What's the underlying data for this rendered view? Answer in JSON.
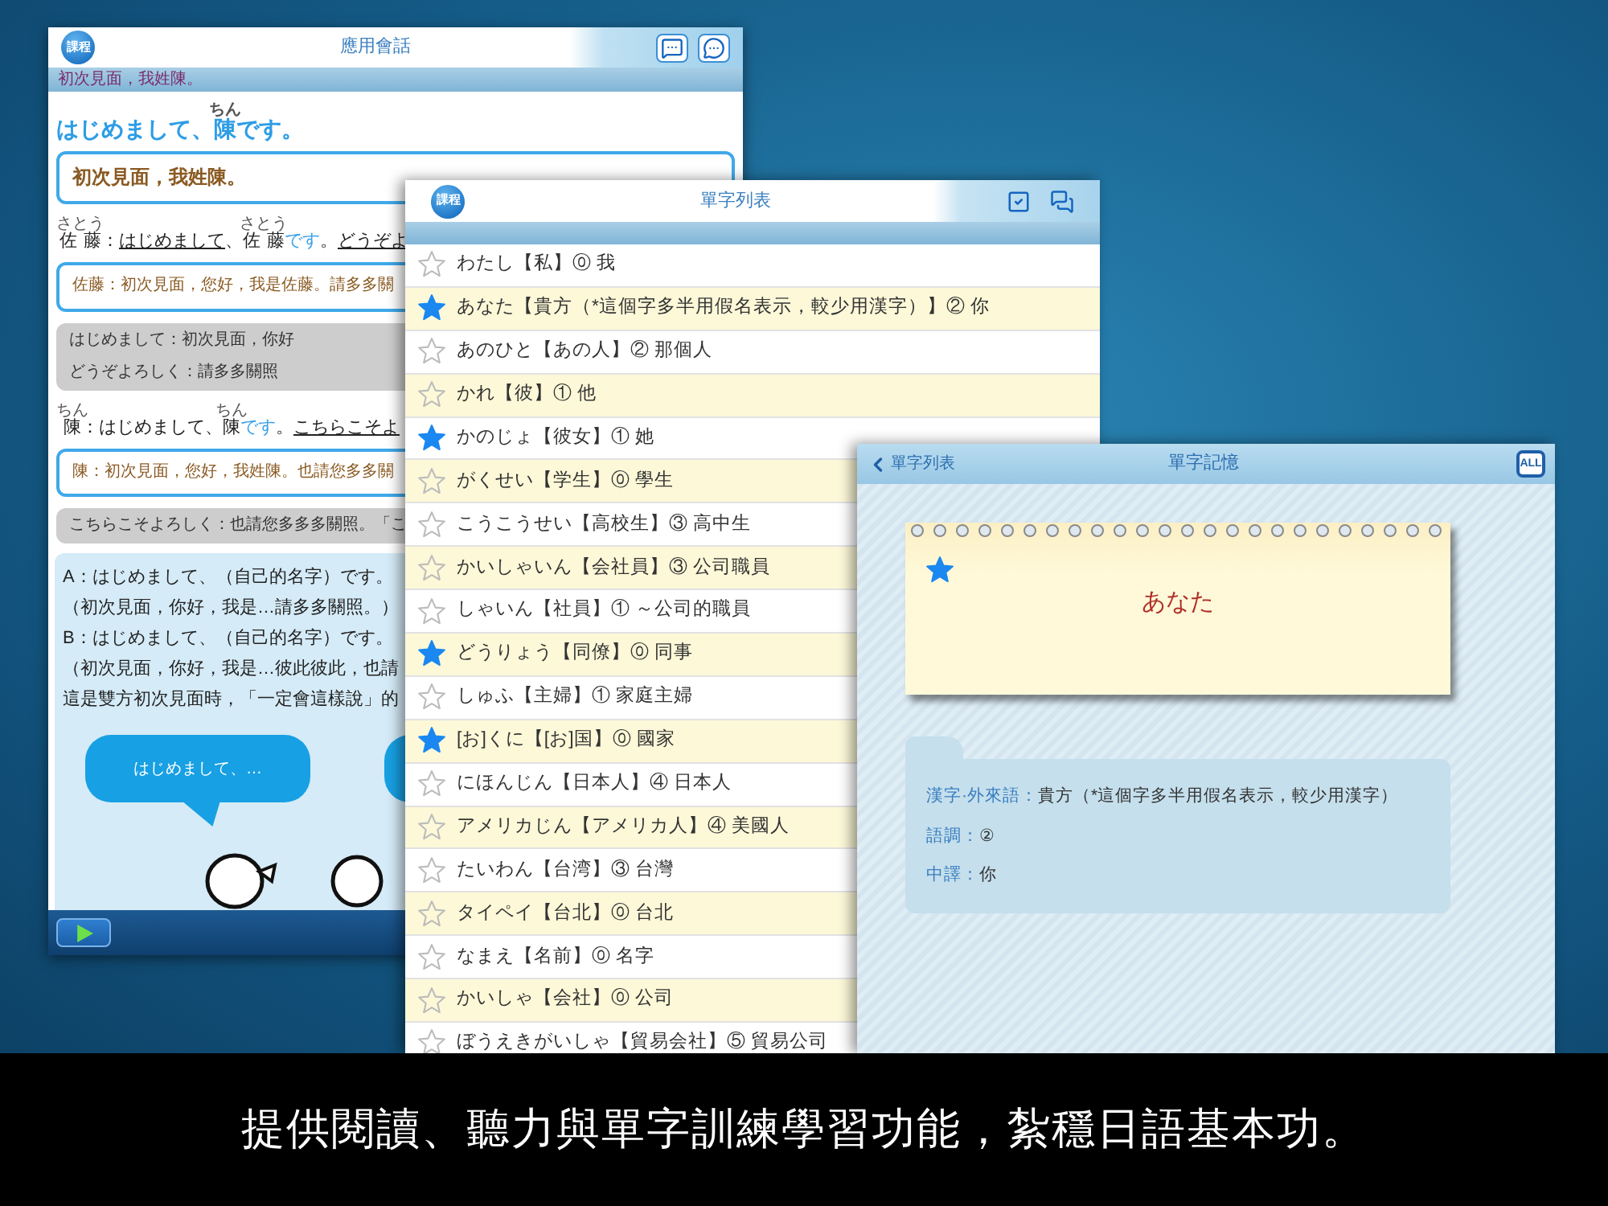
{
  "lesson_window": {
    "logo": "課程",
    "title": "應用會話",
    "subtitle": "初次見面，我姓陳。",
    "blocks": [
      {
        "kind": "headline",
        "segments": [
          {
            "text": "はじめまして、"
          },
          {
            "text": "陳",
            "ruby": "ちん"
          },
          {
            "text": "です"
          },
          {
            "text": "。"
          }
        ]
      },
      {
        "kind": "title_box",
        "lines": [
          "初次見面，我姓陳。"
        ]
      },
      {
        "kind": "speaker",
        "segments": [
          {
            "text": "佐藤",
            "ruby": "さとう"
          },
          {
            "text": "："
          },
          {
            "text": "はじめまして",
            "kind": "phrase"
          },
          {
            "text": "、"
          },
          {
            "text": "佐藤",
            "ruby": "さとう"
          },
          {
            "text": "です",
            "kind": "copula"
          },
          {
            "text": "。"
          },
          {
            "text": "どうぞよ",
            "kind": "phrase"
          }
        ]
      },
      {
        "kind": "translation_box",
        "lines": [
          "佐藤：初次見面，您好，我是佐藤。請多多關"
        ]
      },
      {
        "kind": "notes_box",
        "lines": [
          "はじめまして：初次見面，你好",
          "どうぞよろしく：請多多關照"
        ]
      },
      {
        "kind": "speaker",
        "segments": [
          {
            "text": "陳",
            "ruby": "ちん"
          },
          {
            "text": "：はじめまして、"
          },
          {
            "text": "陳",
            "ruby": "ちん"
          },
          {
            "text": "です",
            "kind": "copula"
          },
          {
            "text": "。"
          },
          {
            "text": "こちらこそよ",
            "kind": "phrase"
          }
        ]
      },
      {
        "kind": "translation_box",
        "lines": [
          "陳：初次見面，您好，我姓陳。也請您多多關"
        ]
      },
      {
        "kind": "notes_box",
        "lines": [
          "こちらこそよろしく：也請您多多多關照。「こ"
        ]
      }
    ],
    "practice_lines": [
      "A：はじめまして、（自己的名字）です。",
      "（初次見面，你好，我是…請多多關照。）",
      "B：はじめまして、（自己的名字）です。",
      "（初次見面，你好，我是…彼此彼此，也請",
      "這是雙方初次見面時，「一定會這樣說」的"
    ],
    "bubble": "はじめまして、…"
  },
  "word_list_window": {
    "logo": "課程",
    "title": "單字列表",
    "rows": [
      {
        "text": "わたし【私】⓪ 我",
        "starred": false
      },
      {
        "text": "あなた【貴方（*這個字多半用假名表示，較少用漢字）】② 你",
        "starred": true
      },
      {
        "text": "あのひと【あの人】② 那個人",
        "starred": false
      },
      {
        "text": "かれ【彼】① 他",
        "starred": false
      },
      {
        "text": "かのじょ【彼女】① 她",
        "starred": true
      },
      {
        "text": "がくせい【学生】⓪ 學生",
        "starred": false
      },
      {
        "text": "こうこうせい【高校生】③ 高中生",
        "starred": false
      },
      {
        "text": "かいしゃいん【会社員】③ 公司職員",
        "starred": false
      },
      {
        "text": "しゃいん【社員】① ～公司的職員",
        "starred": false
      },
      {
        "text": "どうりょう【同僚】⓪ 同事",
        "starred": true
      },
      {
        "text": "しゅふ【主婦】① 家庭主婦",
        "starred": false
      },
      {
        "text": "[お]くに【[お]国】⓪ 國家",
        "starred": true
      },
      {
        "text": "にほんじん【日本人】④ 日本人",
        "starred": false
      },
      {
        "text": "アメリカじん【アメリカ人】④ 美國人",
        "starred": false
      },
      {
        "text": "たいわん【台湾】③ 台灣",
        "starred": false
      },
      {
        "text": "タイペイ【台北】⓪ 台北",
        "starred": false
      },
      {
        "text": "なまえ【名前】⓪ 名字",
        "starred": false
      },
      {
        "text": "かいしゃ【会社】⓪ 公司",
        "starred": false
      },
      {
        "text": "ぼうえきがいしゃ【貿易会社】⑤ 貿易公司",
        "starred": false
      }
    ]
  },
  "flashcard_window": {
    "back": "單字列表",
    "title": "單字記憶",
    "all_button": "ALL",
    "card": {
      "starred": true,
      "word": "あなた"
    },
    "details": [
      {
        "label": "漢字·外來語：",
        "value": "貴方（*這個字多半用假名表示，較少用漢字）"
      },
      {
        "label": "語調：",
        "value": "②"
      },
      {
        "label": "中譯：",
        "value": "你"
      }
    ]
  },
  "caption": "提供閱讀、聽力與單字訓練學習功能，紮穩日語基本功。"
}
